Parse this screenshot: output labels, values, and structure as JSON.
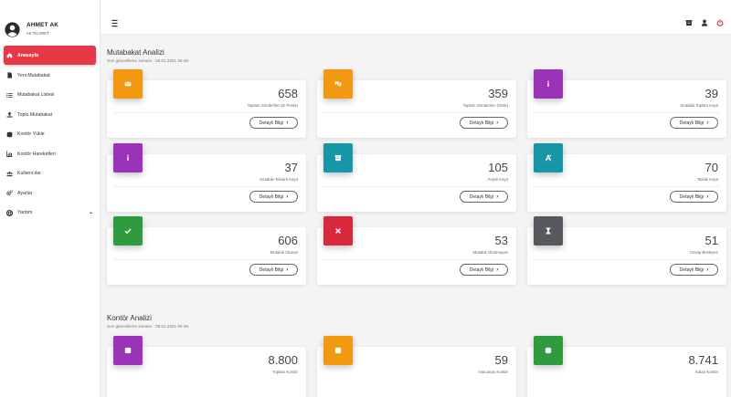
{
  "user": {
    "name": "AHMET AK",
    "company": "AK TİCARET"
  },
  "sidebar": {
    "items": [
      {
        "label": "Anasayfa",
        "icon": "home-icon",
        "active": true
      },
      {
        "label": "Yeni Mutabakat",
        "icon": "file-icon"
      },
      {
        "label": "Mutabakat Listesi",
        "icon": "list-icon"
      },
      {
        "label": "Toplu Mutabakat",
        "icon": "upload-icon"
      },
      {
        "label": "Kontör Yükle",
        "icon": "coins-icon"
      },
      {
        "label": "Kontör Hareketleri",
        "icon": "chart-icon"
      },
      {
        "label": "Kullanıcılar",
        "icon": "users-icon"
      },
      {
        "label": "Ayarlar",
        "icon": "gears-icon"
      },
      {
        "label": "Yardım",
        "icon": "lifebuoy-icon",
        "has_submenu": true
      }
    ]
  },
  "topbar": {
    "icons": [
      "archive-icon",
      "user-icon",
      "power-icon"
    ]
  },
  "reconciliation": {
    "title": "Mutabakat Analizi",
    "updated": "Son güncelleme zamanı : 08.01.2021 08:49",
    "cards": [
      {
        "value": "658",
        "label": "Toplam Gönderilen (E-Posta)",
        "button": "Detaylı Bilgi",
        "color": "#f29a0f",
        "icon": "envelope-icon"
      },
      {
        "value": "359",
        "label": "Toplam Gönderilen (SMS)",
        "button": "Detaylı Bilgi",
        "color": "#f29a0f",
        "icon": "comments-icon"
      },
      {
        "value": "39",
        "label": "Sıradaki Toplam Kayıt",
        "button": "Detaylı Bilgi",
        "color": "#9b33b8",
        "icon": "info-icon"
      },
      {
        "value": "37",
        "label": "Sıradaki Tekrarlı Kayıt",
        "button": "Detaylı Bilgi",
        "color": "#9b33b8",
        "icon": "info-icon"
      },
      {
        "value": "105",
        "label": "Arşivli Kayıt",
        "button": "Detaylı Bilgi",
        "color": "#1597a8",
        "icon": "archive-icon"
      },
      {
        "value": "70",
        "label": "Taslak Kayıt",
        "button": "Detaylı Bilgi",
        "color": "#1597a8",
        "icon": "draft-icon"
      },
      {
        "value": "606",
        "label": "Mutabık Olunan",
        "button": "Detaylı Bilgi",
        "color": "#2e9b3f",
        "icon": "check-icon"
      },
      {
        "value": "53",
        "label": "Mutabık Olunmayan",
        "button": "Detaylı Bilgi",
        "color": "#d9283a",
        "icon": "x-icon"
      },
      {
        "value": "51",
        "label": "Cevap Bekleyen",
        "button": "Detaylı Bilgi",
        "color": "#55585c",
        "icon": "hourglass-icon"
      }
    ]
  },
  "credit": {
    "title": "Kontör Analizi",
    "updated": "Son güncelleme zamanı : 08.01.2021 08:49",
    "cards": [
      {
        "value": "8.800",
        "label": "Toplam Kontör",
        "color": "#9b33b8",
        "icon": "coins-icon"
      },
      {
        "value": "59",
        "label": "Harcanan Kontör",
        "color": "#f29a0f",
        "icon": "coins-icon"
      },
      {
        "value": "8.741",
        "label": "Kalan Kontör",
        "color": "#2e9b3f",
        "icon": "coins-icon"
      }
    ]
  }
}
